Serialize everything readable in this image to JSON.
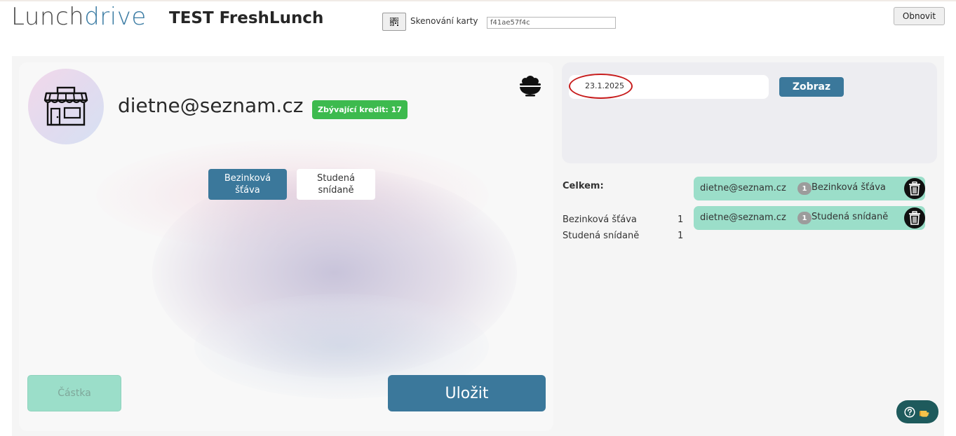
{
  "header": {
    "logo_part1": "Lunch",
    "logo_part2": "drive",
    "app_title": "TEST FreshLunch",
    "scan_label": "Skenování karty",
    "scan_value": "f41ae57f4c",
    "refresh_label": "Obnovit"
  },
  "customer": {
    "email": "dietne@seznam.cz",
    "credit_badge": "Zbývající kredit: 17",
    "avatar_icon": "store-icon",
    "bowl_icon": "food-bowl-icon"
  },
  "items": [
    {
      "label": "Bezinková šťáva",
      "selected": true
    },
    {
      "label": "Studená snídaně",
      "selected": false
    }
  ],
  "actions": {
    "amount_label": "Částka",
    "save_label": "Uložit"
  },
  "filter": {
    "date": "23.1.2025",
    "show_label": "Zobraz"
  },
  "summary": {
    "title": "Celkem:",
    "rows": [
      {
        "name": "Bezinková šťáva",
        "qty": "1"
      },
      {
        "name": "Studená snídaně",
        "qty": "1"
      }
    ]
  },
  "orders": [
    {
      "email": "dietne@seznam.cz",
      "qty": "1",
      "item": "Bezinková šťáva"
    },
    {
      "email": "dietne@seznam.cz",
      "qty": "1",
      "item": "Studená snídaně"
    }
  ],
  "colors": {
    "accent": "#3b789b",
    "credit": "#3dba4e",
    "order_bg": "#9bdec9",
    "highlight_ring": "#c71c1c"
  }
}
